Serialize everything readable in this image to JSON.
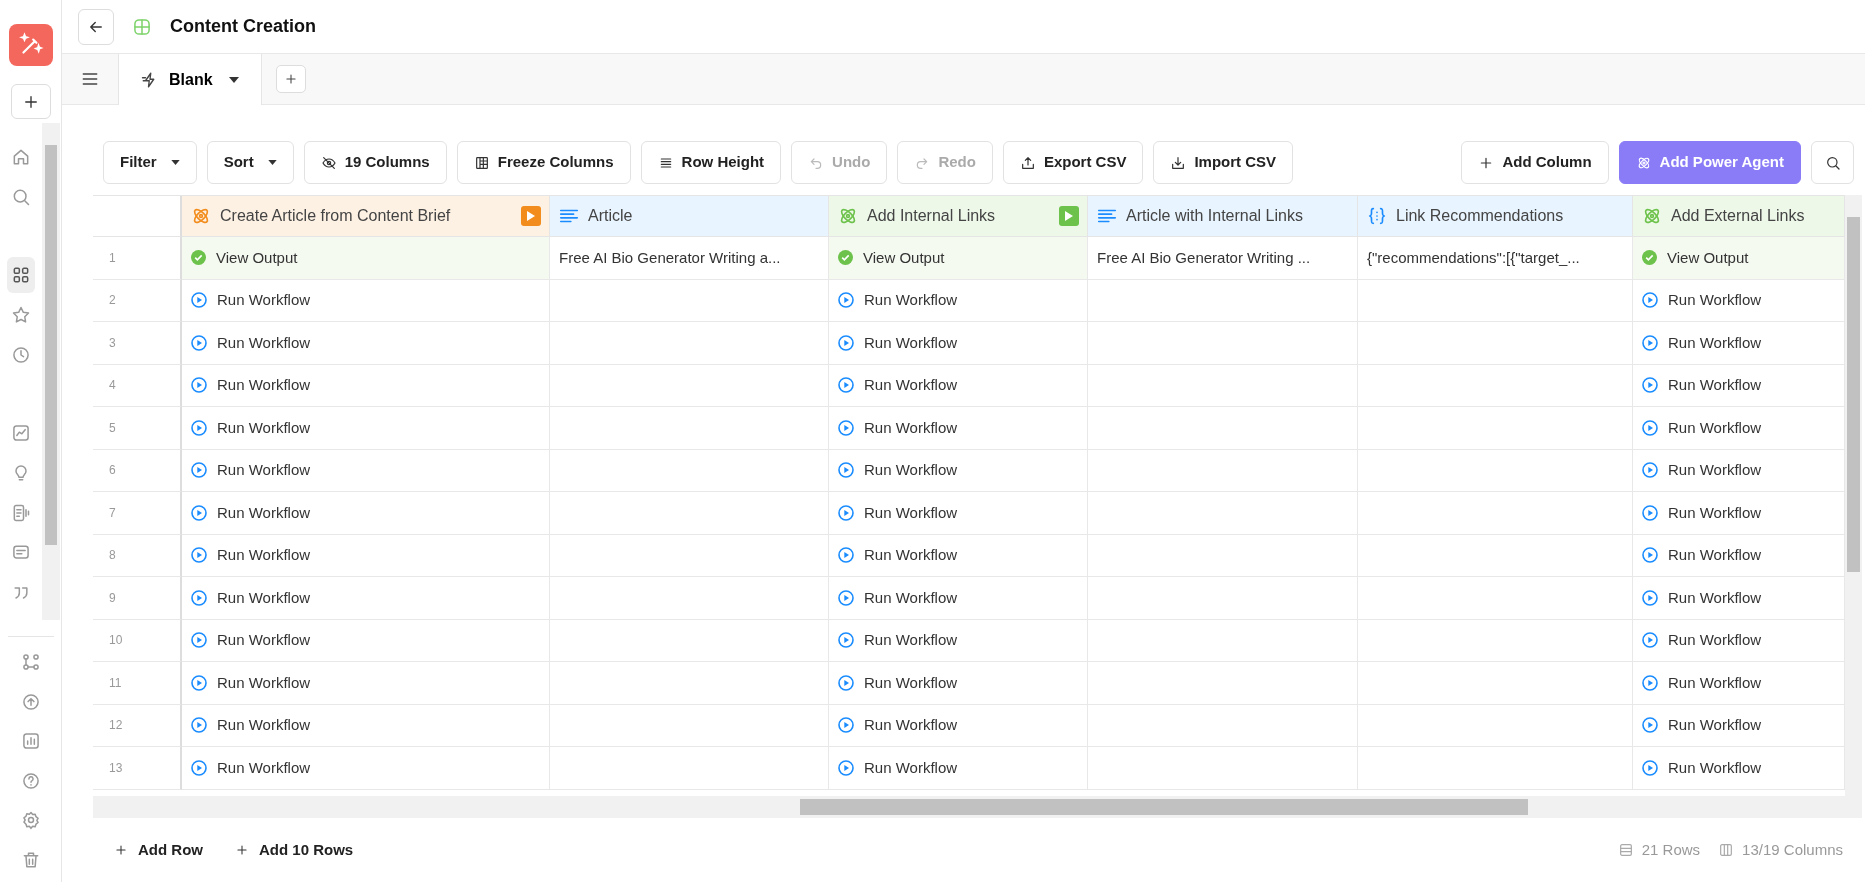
{
  "sidebar": {
    "nav_items": [
      {
        "selected": false
      },
      {
        "selected": false
      },
      {
        "selected": true
      },
      {
        "selected": false
      },
      {
        "selected": false
      },
      {
        "selected": false
      },
      {
        "selected": false
      },
      {
        "selected": false
      },
      {
        "selected": false
      },
      {
        "selected": false
      }
    ],
    "bottom_items": [
      {
        "selected": false
      },
      {
        "selected": false
      },
      {
        "selected": false
      },
      {
        "selected": false
      },
      {
        "selected": false
      },
      {
        "selected": false
      }
    ]
  },
  "header": {
    "title": "Content Creation"
  },
  "tabs": [
    {
      "label": "Blank",
      "selected": true
    }
  ],
  "toolbar": {
    "left": [
      {
        "label": "Filter",
        "kind": "dropdown",
        "disabled": false
      },
      {
        "label": "Sort",
        "kind": "dropdown",
        "disabled": false
      },
      {
        "label": "19 Columns",
        "kind": "plain",
        "disabled": false
      },
      {
        "label": "Freeze Columns",
        "kind": "plain",
        "disabled": false
      },
      {
        "label": "Row Height",
        "kind": "plain",
        "disabled": false
      },
      {
        "label": "Undo",
        "kind": "plain",
        "disabled": true
      },
      {
        "label": "Redo",
        "kind": "plain",
        "disabled": true
      },
      {
        "label": "Export CSV",
        "kind": "plain",
        "disabled": false
      },
      {
        "label": "Import CSV",
        "kind": "plain",
        "disabled": false
      }
    ],
    "right": [
      {
        "label": "Add Column",
        "kind": "plain",
        "disabled": false
      },
      {
        "label": "Add Power Agent",
        "kind": "primary",
        "disabled": false
      }
    ]
  },
  "table": {
    "columns": [
      {
        "label": "Create Article from Content Brief",
        "kind": "agent",
        "color": "#f28c1c",
        "run_button": true
      },
      {
        "label": "Article",
        "kind": "text",
        "color": "#1a8cff",
        "run_button": false
      },
      {
        "label": "Add Internal Links",
        "kind": "agent",
        "color": "#6cc24a",
        "run_button": true
      },
      {
        "label": "Article with Internal Links",
        "kind": "text",
        "color": "#1a8cff",
        "run_button": false
      },
      {
        "label": "Link Recommendations",
        "kind": "json",
        "color": "#1a8cff",
        "run_button": false
      },
      {
        "label": "Add External Links",
        "kind": "agent",
        "color": "#6cc24a",
        "run_button": false
      }
    ],
    "rows": [
      {
        "number": "1",
        "cells": [
          {
            "kind": "output",
            "text": "View Output"
          },
          {
            "kind": "text",
            "text": "Free AI Bio Generator Writing a..."
          },
          {
            "kind": "output",
            "text": "View Output"
          },
          {
            "kind": "text",
            "text": "Free AI Bio Generator Writing ..."
          },
          {
            "kind": "text",
            "text": "{\"recommendations\":[{\"target_..."
          },
          {
            "kind": "output",
            "text": "View Output"
          }
        ]
      },
      {
        "number": "2",
        "cells": [
          {
            "kind": "run",
            "text": "Run Workflow"
          },
          {
            "kind": "empty"
          },
          {
            "kind": "run",
            "text": "Run Workflow"
          },
          {
            "kind": "empty"
          },
          {
            "kind": "empty"
          },
          {
            "kind": "run",
            "text": "Run Workflow"
          }
        ]
      },
      {
        "number": "3",
        "cells": [
          {
            "kind": "run",
            "text": "Run Workflow"
          },
          {
            "kind": "empty"
          },
          {
            "kind": "run",
            "text": "Run Workflow"
          },
          {
            "kind": "empty"
          },
          {
            "kind": "empty"
          },
          {
            "kind": "run",
            "text": "Run Workflow"
          }
        ]
      },
      {
        "number": "4",
        "cells": [
          {
            "kind": "run",
            "text": "Run Workflow"
          },
          {
            "kind": "empty"
          },
          {
            "kind": "run",
            "text": "Run Workflow"
          },
          {
            "kind": "empty"
          },
          {
            "kind": "empty"
          },
          {
            "kind": "run",
            "text": "Run Workflow"
          }
        ]
      },
      {
        "number": "5",
        "cells": [
          {
            "kind": "run",
            "text": "Run Workflow"
          },
          {
            "kind": "empty"
          },
          {
            "kind": "run",
            "text": "Run Workflow"
          },
          {
            "kind": "empty"
          },
          {
            "kind": "empty"
          },
          {
            "kind": "run",
            "text": "Run Workflow"
          }
        ]
      },
      {
        "number": "6",
        "cells": [
          {
            "kind": "run",
            "text": "Run Workflow"
          },
          {
            "kind": "empty"
          },
          {
            "kind": "run",
            "text": "Run Workflow"
          },
          {
            "kind": "empty"
          },
          {
            "kind": "empty"
          },
          {
            "kind": "run",
            "text": "Run Workflow"
          }
        ]
      },
      {
        "number": "7",
        "cells": [
          {
            "kind": "run",
            "text": "Run Workflow"
          },
          {
            "kind": "empty"
          },
          {
            "kind": "run",
            "text": "Run Workflow"
          },
          {
            "kind": "empty"
          },
          {
            "kind": "empty"
          },
          {
            "kind": "run",
            "text": "Run Workflow"
          }
        ]
      },
      {
        "number": "8",
        "cells": [
          {
            "kind": "run",
            "text": "Run Workflow"
          },
          {
            "kind": "empty"
          },
          {
            "kind": "run",
            "text": "Run Workflow"
          },
          {
            "kind": "empty"
          },
          {
            "kind": "empty"
          },
          {
            "kind": "run",
            "text": "Run Workflow"
          }
        ]
      },
      {
        "number": "9",
        "cells": [
          {
            "kind": "run",
            "text": "Run Workflow"
          },
          {
            "kind": "empty"
          },
          {
            "kind": "run",
            "text": "Run Workflow"
          },
          {
            "kind": "empty"
          },
          {
            "kind": "empty"
          },
          {
            "kind": "run",
            "text": "Run Workflow"
          }
        ]
      },
      {
        "number": "10",
        "cells": [
          {
            "kind": "run",
            "text": "Run Workflow"
          },
          {
            "kind": "empty"
          },
          {
            "kind": "run",
            "text": "Run Workflow"
          },
          {
            "kind": "empty"
          },
          {
            "kind": "empty"
          },
          {
            "kind": "run",
            "text": "Run Workflow"
          }
        ]
      },
      {
        "number": "11",
        "cells": [
          {
            "kind": "run",
            "text": "Run Workflow"
          },
          {
            "kind": "empty"
          },
          {
            "kind": "run",
            "text": "Run Workflow"
          },
          {
            "kind": "empty"
          },
          {
            "kind": "empty"
          },
          {
            "kind": "run",
            "text": "Run Workflow"
          }
        ]
      },
      {
        "number": "12",
        "cells": [
          {
            "kind": "run",
            "text": "Run Workflow"
          },
          {
            "kind": "empty"
          },
          {
            "kind": "run",
            "text": "Run Workflow"
          },
          {
            "kind": "empty"
          },
          {
            "kind": "empty"
          },
          {
            "kind": "run",
            "text": "Run Workflow"
          }
        ]
      },
      {
        "number": "13",
        "cells": [
          {
            "kind": "run",
            "text": "Run Workflow"
          },
          {
            "kind": "empty"
          },
          {
            "kind": "run",
            "text": "Run Workflow"
          },
          {
            "kind": "empty"
          },
          {
            "kind": "empty"
          },
          {
            "kind": "run",
            "text": "Run Workflow"
          }
        ]
      }
    ]
  },
  "footer": {
    "actions": [
      "Add Row",
      "Add 10 Rows"
    ],
    "row_count": "21 Rows",
    "column_count": "13/19 Columns"
  }
}
